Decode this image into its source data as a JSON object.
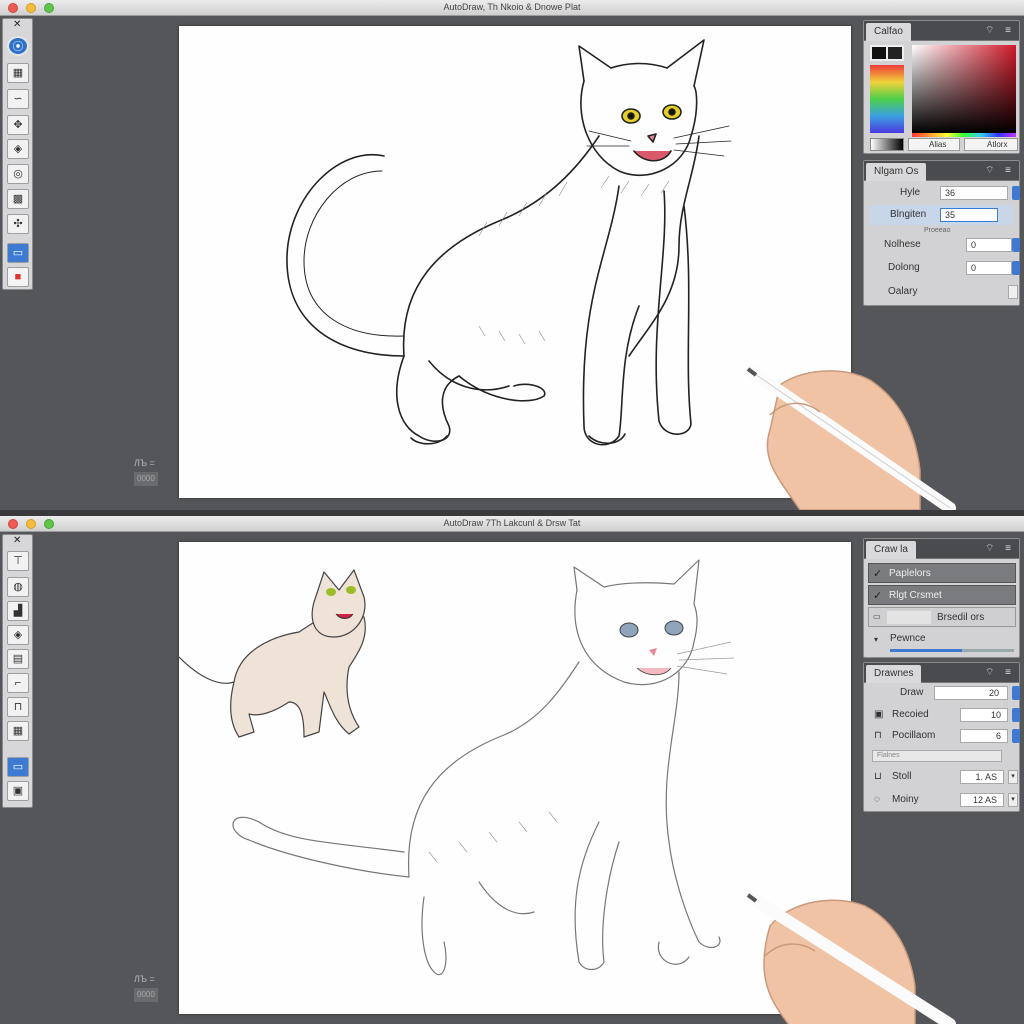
{
  "top_window": {
    "title": "AutoDraw, Th Nkoio & Dnowe Plat",
    "toolbar": {
      "close_glyph": "✕"
    },
    "coords": {
      "readout": "ЛЪ =",
      "box": "0000"
    },
    "color_panel": {
      "tab": "Calfao",
      "btn_alias": "Alias",
      "btn_autorx": "Atlorx"
    },
    "props_panel": {
      "tab": "Nlgam Os",
      "rows": [
        {
          "label": "Hyle",
          "value": "36"
        },
        {
          "label": "Blngiten",
          "value": "35"
        },
        {
          "label": "Nolhese",
          "value": "0"
        },
        {
          "label": "Dolong",
          "value": "0"
        },
        {
          "label": "Oalary",
          "value": ""
        }
      ],
      "hint": "Proeeao"
    }
  },
  "bottom_window": {
    "title": "AutoDraw 7Th Lakcunl & Drsw Tat",
    "toolbar": {
      "close_glyph": "✕"
    },
    "coords": {
      "readout": "ЛЪ =",
      "box": "0000"
    },
    "layers_panel": {
      "tab": "Craw la",
      "items": [
        {
          "check": "✓",
          "label": "Paplelors"
        },
        {
          "check": "✓",
          "label": "Rlgt Crsmet"
        },
        {
          "check": "",
          "label": "Brsedil ors"
        }
      ],
      "slider_label": "Pewnce",
      "slider_value": 0.58
    },
    "drawing_panel": {
      "tab": "Drawnes",
      "rows": [
        {
          "label": "Draw",
          "value": "20"
        },
        {
          "label": "Recoied",
          "value": "10"
        },
        {
          "label": "Pocillaom",
          "value": "6"
        },
        {
          "label": "Stoll",
          "value": "1. AS"
        },
        {
          "label": "Moiny",
          "value": "12 AS"
        }
      ],
      "hint": "Flalnes"
    }
  },
  "colors": {
    "accent": "#3f7ad0",
    "panel_bg": "#d2d2d4",
    "window_bg": "#555659"
  }
}
